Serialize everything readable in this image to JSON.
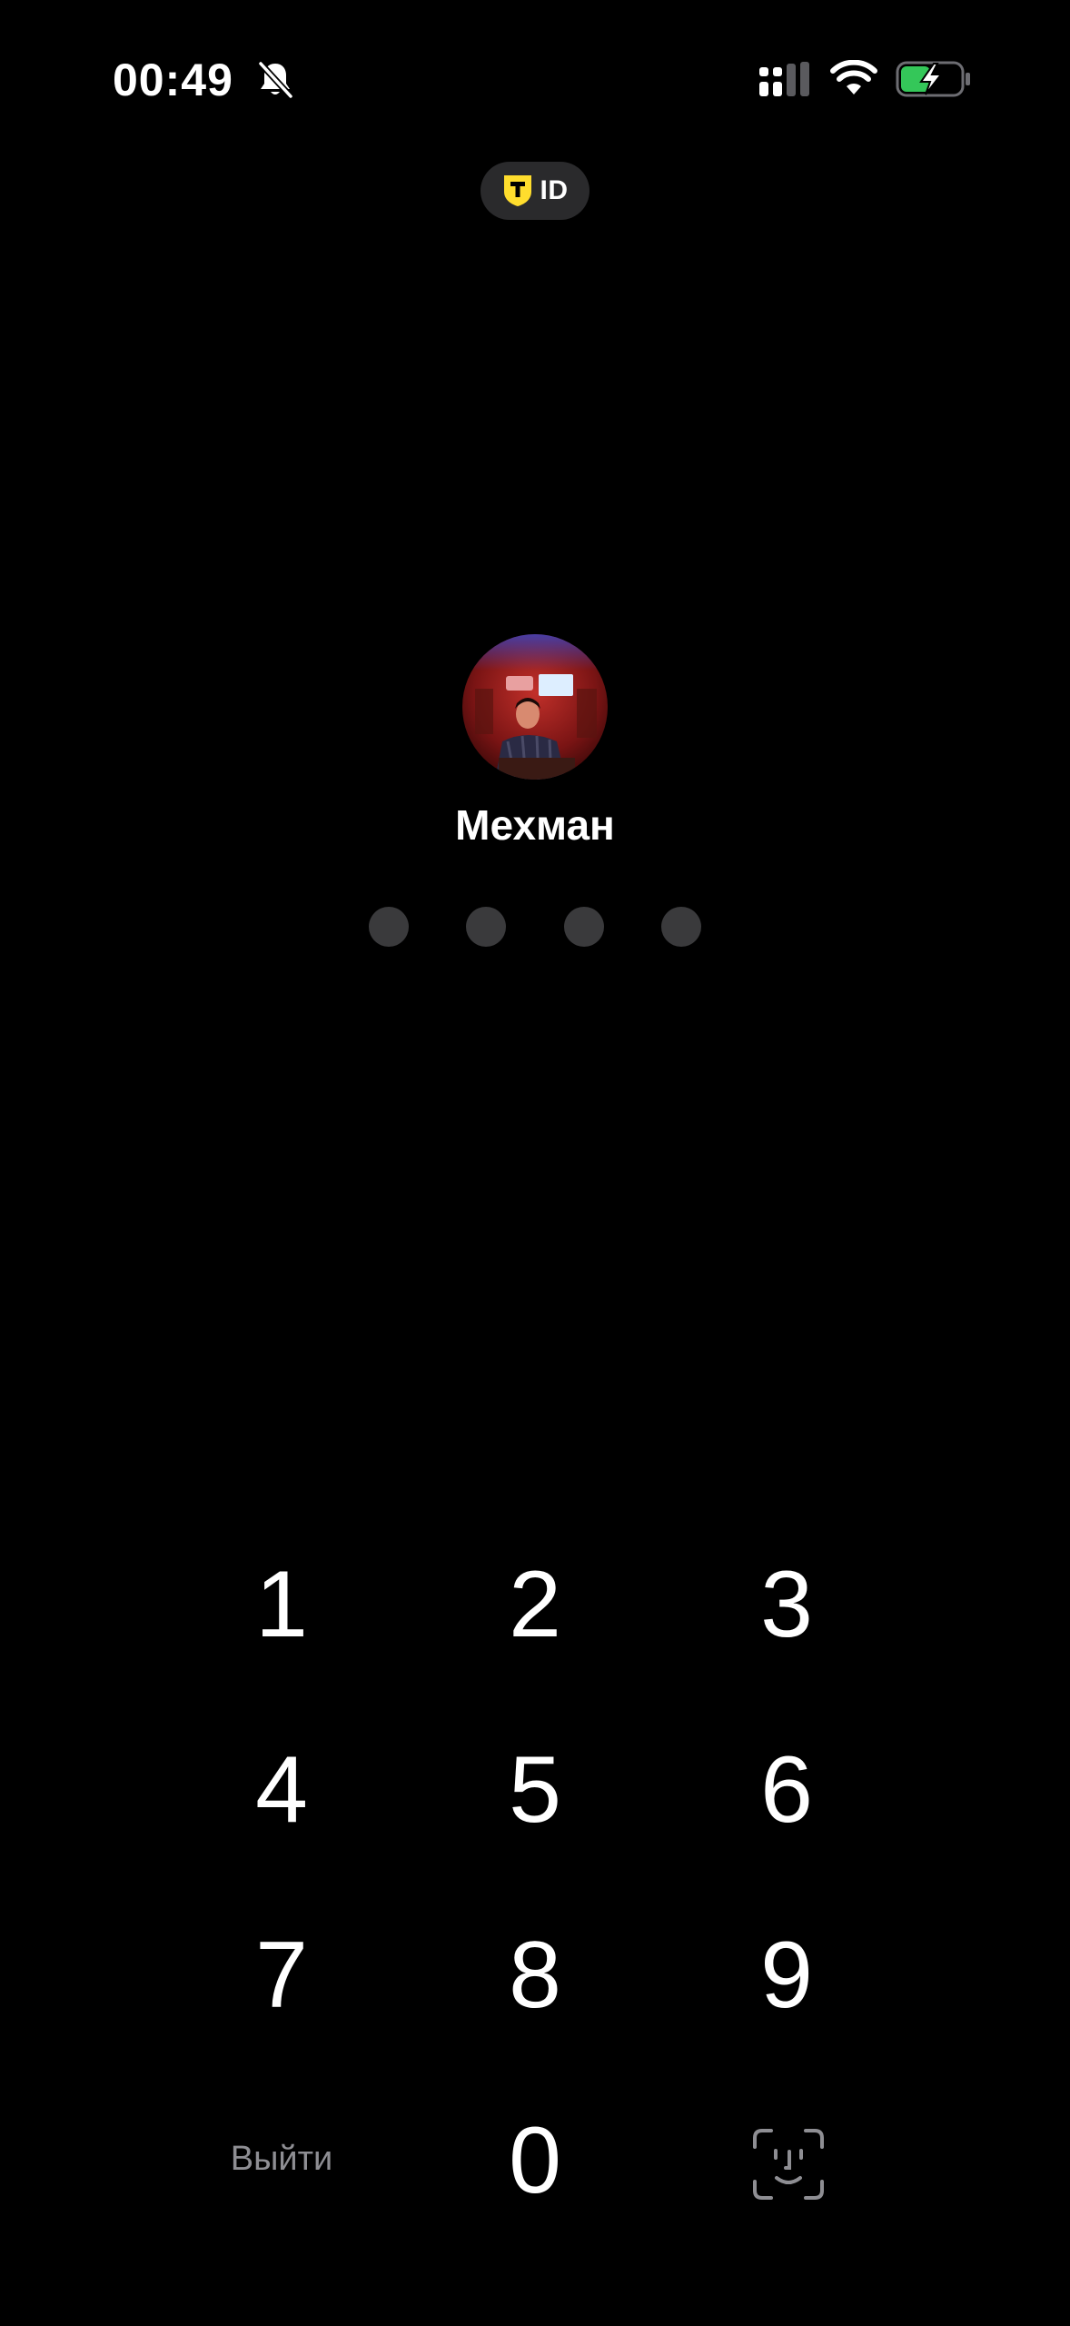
{
  "status_bar": {
    "time": "00:49",
    "silent_icon": "bell-slash-icon",
    "signal_icon": "cellular-signal-icon",
    "wifi_icon": "wifi-icon",
    "battery_icon": "battery-charging-icon",
    "battery_level_fraction": 0.5,
    "battery_color": "#34c759"
  },
  "brand": {
    "logo_icon": "tbank-shield-icon",
    "label": "ID",
    "accent_color": "#ffdd2d"
  },
  "profile": {
    "avatar": "avatar-photo",
    "name": "Мехман"
  },
  "pin": {
    "length": 4,
    "entered": 0
  },
  "keypad": {
    "keys": [
      "1",
      "2",
      "3",
      "4",
      "5",
      "6",
      "7",
      "8",
      "9",
      "0"
    ],
    "exit_label": "Выйти",
    "biometric_icon": "face-id-icon"
  }
}
